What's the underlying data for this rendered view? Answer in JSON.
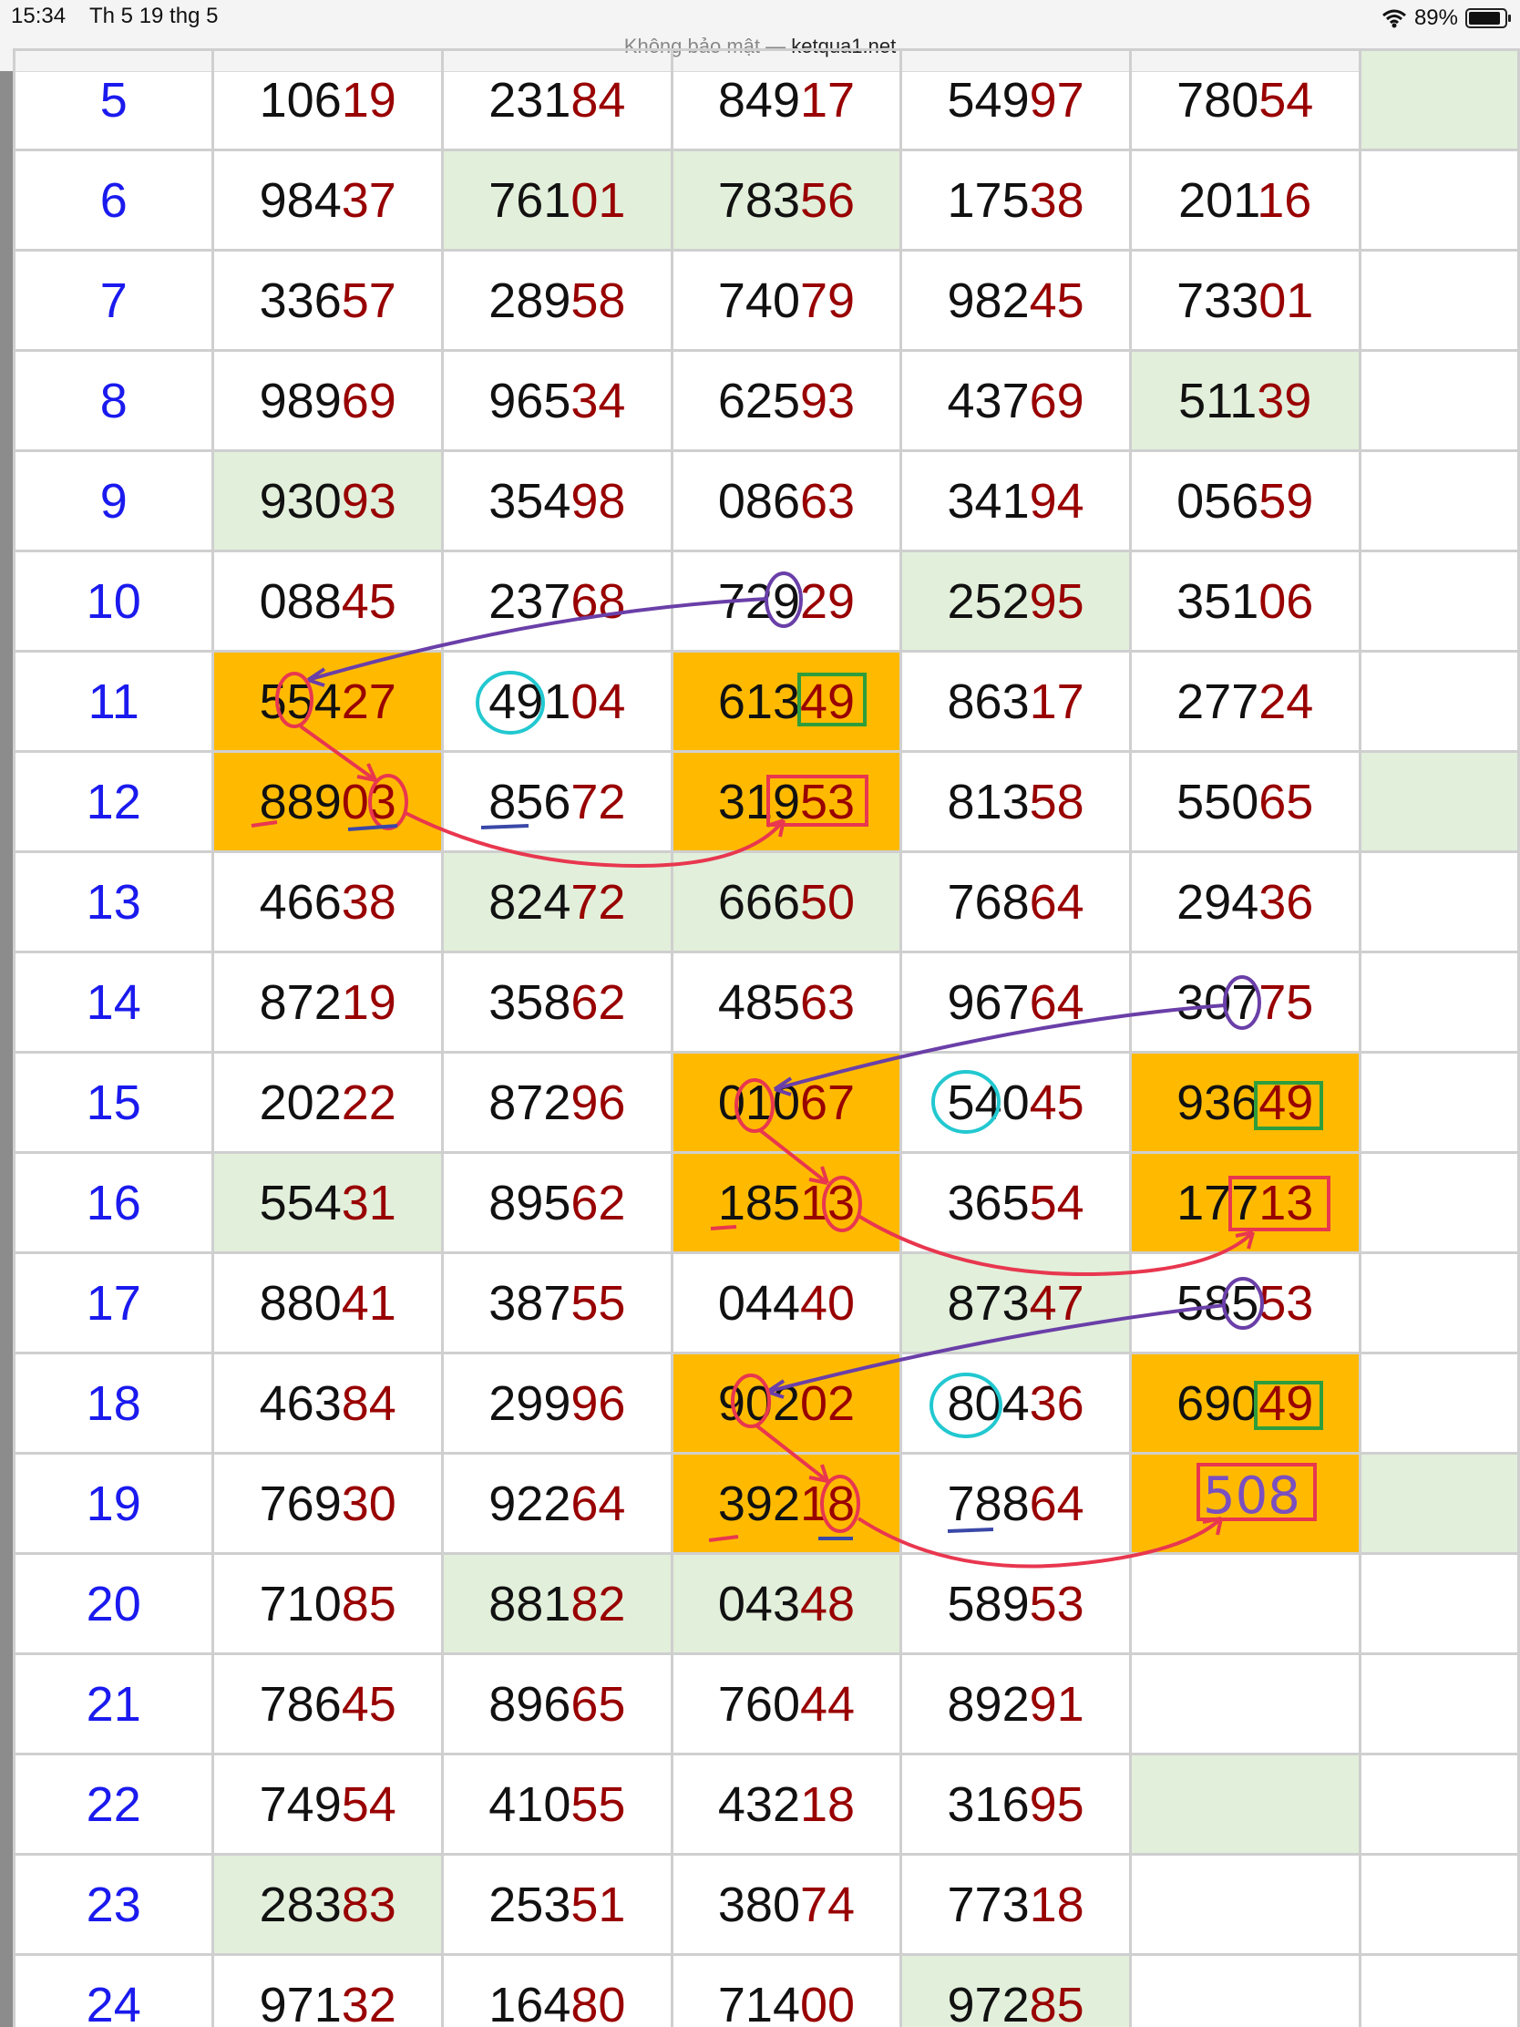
{
  "status": {
    "time": "15:34",
    "date": "Th 5 19 thg 5",
    "battery": "89%",
    "battery_level": 0.89,
    "url_prefix": "Không bảo mật — ",
    "url_host": "ketqua1.net"
  },
  "table": {
    "rows": [
      {
        "n": "5",
        "cells": [
          {
            "v": "10619",
            "bg": ""
          },
          {
            "v": "23184",
            "bg": ""
          },
          {
            "v": "84917",
            "bg": ""
          },
          {
            "v": "54997",
            "bg": ""
          },
          {
            "v": "78054",
            "bg": ""
          },
          {
            "v": "",
            "bg": "green"
          }
        ]
      },
      {
        "n": "6",
        "cells": [
          {
            "v": "98437",
            "bg": ""
          },
          {
            "v": "76101",
            "bg": "green"
          },
          {
            "v": "78356",
            "bg": "green"
          },
          {
            "v": "17538",
            "bg": ""
          },
          {
            "v": "20116",
            "bg": ""
          },
          {
            "v": "",
            "bg": ""
          }
        ]
      },
      {
        "n": "7",
        "cells": [
          {
            "v": "33657",
            "bg": ""
          },
          {
            "v": "28958",
            "bg": ""
          },
          {
            "v": "74079",
            "bg": ""
          },
          {
            "v": "98245",
            "bg": ""
          },
          {
            "v": "73301",
            "bg": ""
          },
          {
            "v": "",
            "bg": ""
          }
        ]
      },
      {
        "n": "8",
        "cells": [
          {
            "v": "98969",
            "bg": ""
          },
          {
            "v": "96534",
            "bg": ""
          },
          {
            "v": "62593",
            "bg": ""
          },
          {
            "v": "43769",
            "bg": ""
          },
          {
            "v": "51139",
            "bg": "green"
          },
          {
            "v": "",
            "bg": ""
          }
        ]
      },
      {
        "n": "9",
        "cells": [
          {
            "v": "93093",
            "bg": "green"
          },
          {
            "v": "35498",
            "bg": ""
          },
          {
            "v": "08663",
            "bg": ""
          },
          {
            "v": "34194",
            "bg": ""
          },
          {
            "v": "05659",
            "bg": ""
          },
          {
            "v": "",
            "bg": ""
          }
        ]
      },
      {
        "n": "10",
        "cells": [
          {
            "v": "08845",
            "bg": ""
          },
          {
            "v": "23768",
            "bg": ""
          },
          {
            "v": "72929",
            "bg": ""
          },
          {
            "v": "25295",
            "bg": "green"
          },
          {
            "v": "35106",
            "bg": ""
          },
          {
            "v": "",
            "bg": ""
          }
        ]
      },
      {
        "n": "11",
        "cells": [
          {
            "v": "55427",
            "bg": "orange"
          },
          {
            "v": "49104",
            "bg": ""
          },
          {
            "v": "61349",
            "bg": "orange"
          },
          {
            "v": "86317",
            "bg": ""
          },
          {
            "v": "27724",
            "bg": ""
          },
          {
            "v": "",
            "bg": ""
          }
        ]
      },
      {
        "n": "12",
        "cells": [
          {
            "v": "88903",
            "bg": "orange"
          },
          {
            "v": "85672",
            "bg": ""
          },
          {
            "v": "31953",
            "bg": "orange"
          },
          {
            "v": "81358",
            "bg": ""
          },
          {
            "v": "55065",
            "bg": ""
          },
          {
            "v": "",
            "bg": "green"
          }
        ]
      },
      {
        "n": "13",
        "cells": [
          {
            "v": "46638",
            "bg": ""
          },
          {
            "v": "82472",
            "bg": "green"
          },
          {
            "v": "66650",
            "bg": "green"
          },
          {
            "v": "76864",
            "bg": ""
          },
          {
            "v": "29436",
            "bg": ""
          },
          {
            "v": "",
            "bg": ""
          }
        ]
      },
      {
        "n": "14",
        "cells": [
          {
            "v": "87219",
            "bg": ""
          },
          {
            "v": "35862",
            "bg": ""
          },
          {
            "v": "48563",
            "bg": ""
          },
          {
            "v": "96764",
            "bg": ""
          },
          {
            "v": "30775",
            "bg": ""
          },
          {
            "v": "",
            "bg": ""
          }
        ]
      },
      {
        "n": "15",
        "cells": [
          {
            "v": "20222",
            "bg": ""
          },
          {
            "v": "87296",
            "bg": ""
          },
          {
            "v": "01067",
            "bg": "orange"
          },
          {
            "v": "54045",
            "bg": ""
          },
          {
            "v": "93649",
            "bg": "orange"
          },
          {
            "v": "",
            "bg": ""
          }
        ]
      },
      {
        "n": "16",
        "cells": [
          {
            "v": "55431",
            "bg": "green"
          },
          {
            "v": "89562",
            "bg": ""
          },
          {
            "v": "18513",
            "bg": "orange"
          },
          {
            "v": "36554",
            "bg": ""
          },
          {
            "v": "17713",
            "bg": "orange"
          },
          {
            "v": "",
            "bg": ""
          }
        ]
      },
      {
        "n": "17",
        "cells": [
          {
            "v": "88041",
            "bg": ""
          },
          {
            "v": "38755",
            "bg": ""
          },
          {
            "v": "04440",
            "bg": ""
          },
          {
            "v": "87347",
            "bg": "green"
          },
          {
            "v": "58553",
            "bg": ""
          },
          {
            "v": "",
            "bg": ""
          }
        ]
      },
      {
        "n": "18",
        "cells": [
          {
            "v": "46384",
            "bg": ""
          },
          {
            "v": "29996",
            "bg": ""
          },
          {
            "v": "90202",
            "bg": "orange"
          },
          {
            "v": "80436",
            "bg": ""
          },
          {
            "v": "69049",
            "bg": "orange"
          },
          {
            "v": "",
            "bg": ""
          }
        ]
      },
      {
        "n": "19",
        "cells": [
          {
            "v": "76930",
            "bg": ""
          },
          {
            "v": "92264",
            "bg": ""
          },
          {
            "v": "39218",
            "bg": "orange"
          },
          {
            "v": "78864",
            "bg": ""
          },
          {
            "v": "",
            "bg": "orange"
          },
          {
            "v": "",
            "bg": "green"
          }
        ]
      },
      {
        "n": "20",
        "cells": [
          {
            "v": "71085",
            "bg": ""
          },
          {
            "v": "88182",
            "bg": "green"
          },
          {
            "v": "04348",
            "bg": "green"
          },
          {
            "v": "58953",
            "bg": ""
          },
          {
            "v": "",
            "bg": ""
          },
          {
            "v": "",
            "bg": ""
          }
        ]
      },
      {
        "n": "21",
        "cells": [
          {
            "v": "78645",
            "bg": ""
          },
          {
            "v": "89665",
            "bg": ""
          },
          {
            "v": "76044",
            "bg": ""
          },
          {
            "v": "89291",
            "bg": ""
          },
          {
            "v": "",
            "bg": ""
          },
          {
            "v": "",
            "bg": ""
          }
        ]
      },
      {
        "n": "22",
        "cells": [
          {
            "v": "74954",
            "bg": ""
          },
          {
            "v": "41055",
            "bg": ""
          },
          {
            "v": "43218",
            "bg": ""
          },
          {
            "v": "31695",
            "bg": ""
          },
          {
            "v": "",
            "bg": "green"
          },
          {
            "v": "",
            "bg": ""
          }
        ]
      },
      {
        "n": "23",
        "cells": [
          {
            "v": "28383",
            "bg": "green"
          },
          {
            "v": "25351",
            "bg": ""
          },
          {
            "v": "38074",
            "bg": ""
          },
          {
            "v": "77318",
            "bg": ""
          },
          {
            "v": "",
            "bg": ""
          },
          {
            "v": "",
            "bg": ""
          }
        ]
      },
      {
        "n": "24",
        "cells": [
          {
            "v": "97132",
            "bg": ""
          },
          {
            "v": "16480",
            "bg": ""
          },
          {
            "v": "71400",
            "bg": ""
          },
          {
            "v": "97285",
            "bg": "green"
          },
          {
            "v": "",
            "bg": ""
          },
          {
            "v": "",
            "bg": ""
          }
        ]
      }
    ]
  },
  "annotation": {
    "prediction_text": "508"
  },
  "colors": {
    "row_number": "#1a1aee",
    "leading_digits": "#111111",
    "trailing_digits": "#990000",
    "highlight_green": "#e2efdb",
    "highlight_orange": "#ffba00",
    "ink_red": "#e8374f",
    "ink_purple": "#6a3fa8",
    "ink_cyan": "#22c8d0",
    "ink_green": "#2e9e3c",
    "ink_blue": "#3a48a8"
  }
}
